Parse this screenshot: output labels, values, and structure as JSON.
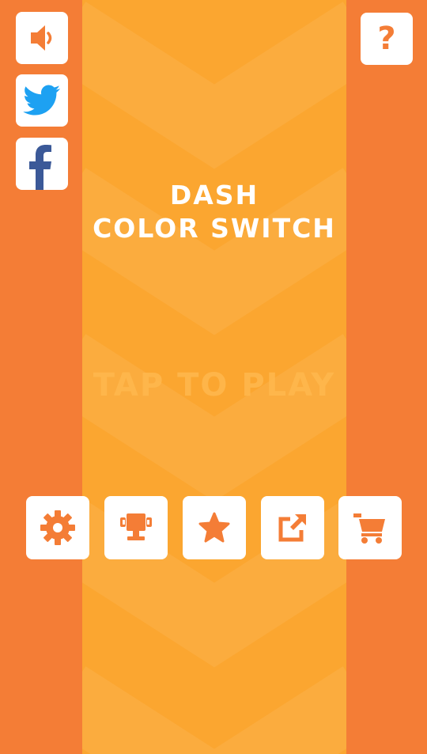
{
  "colors": {
    "background": "#F47D36",
    "lane": "#FBA630",
    "button": "#FFFFFF",
    "icon_orange": "#F47D36",
    "twitter_blue": "#1DA1F2",
    "facebook_blue": "#3B5998",
    "tap_text": "#FFB84E"
  },
  "title": {
    "line1": "DASH",
    "line2": "COLOR SWITCH"
  },
  "tap_to_play": "TAP TO PLAY",
  "left_buttons": [
    {
      "icon": "speaker-icon"
    },
    {
      "icon": "twitter-icon"
    },
    {
      "icon": "facebook-icon"
    }
  ],
  "help_button": {
    "icon": "question-mark-icon",
    "glyph": "?"
  },
  "bottom_buttons": [
    {
      "icon": "gear-icon"
    },
    {
      "icon": "trophy-icon"
    },
    {
      "icon": "star-icon"
    },
    {
      "icon": "share-icon"
    },
    {
      "icon": "cart-icon"
    }
  ]
}
